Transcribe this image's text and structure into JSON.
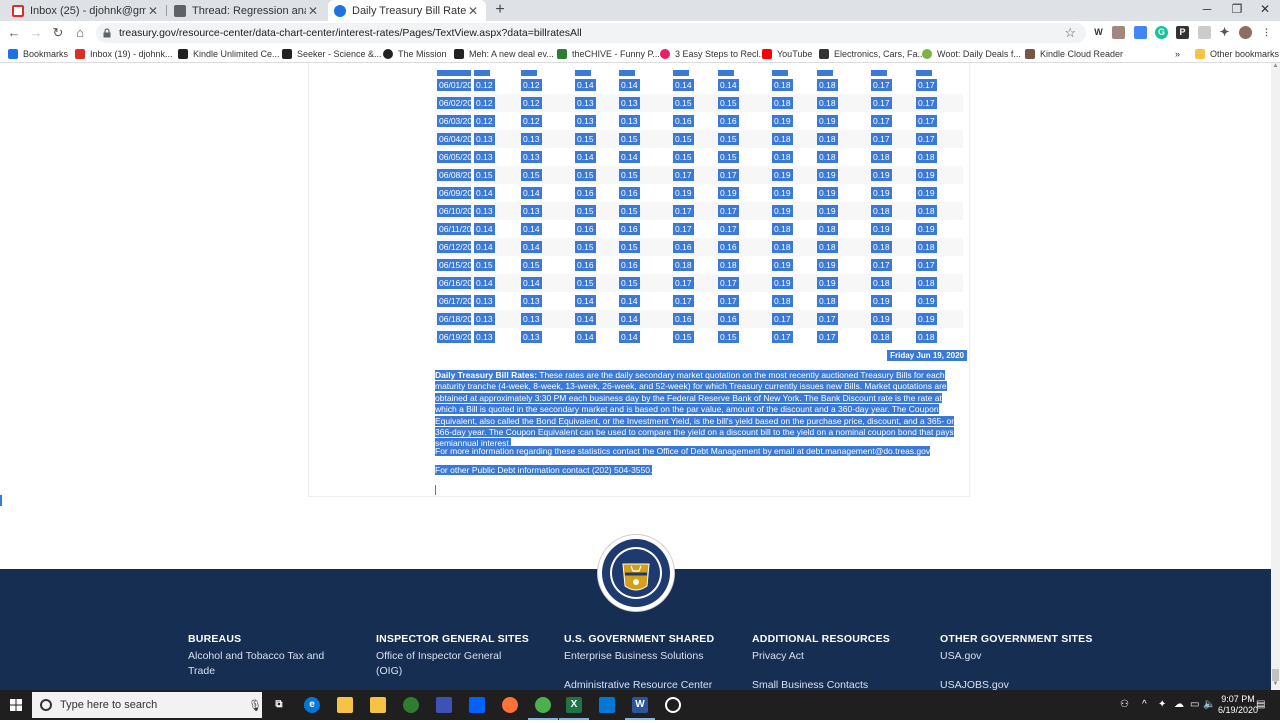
{
  "browser": {
    "tabs": [
      {
        "title": "Inbox (25) - djohnk@gmail.com",
        "favicon_color": "#d93025",
        "active": false
      },
      {
        "title": "Thread: Regression analysis to ca",
        "favicon_color": "#5f6368",
        "active": false
      },
      {
        "title": "Daily Treasury Bill Rates Data",
        "favicon_color": "#1a73e8",
        "active": true
      }
    ],
    "new_tab": "+",
    "window_controls": {
      "minimize": "─",
      "restore": "❐",
      "close": "✕"
    },
    "nav": {
      "back": "←",
      "forward": "→",
      "reload": "↻",
      "home": "⌂"
    },
    "url": "treasury.gov/resource-center/data-chart-center/interest-rates/Pages/TextView.aspx?data=billratesAll",
    "bookmark_star": "☆",
    "bookmarks": [
      {
        "label": "Bookmarks",
        "color": "#1a73e8"
      },
      {
        "label": "Inbox (19) - djohnk...",
        "color": "#d93025"
      },
      {
        "label": "Kindle Unlimited Ce...",
        "color": "#222"
      },
      {
        "label": "Seeker - Science &...",
        "color": "#222"
      },
      {
        "label": "The Mission",
        "color": "#222"
      },
      {
        "label": "Meh: A new deal ev...",
        "color": "#222"
      },
      {
        "label": "theCHIVE - Funny P...",
        "color": "#2e7d32"
      },
      {
        "label": "3 Easy Steps to Recl...",
        "color": "#e91e63"
      },
      {
        "label": "YouTube",
        "color": "#ff0000"
      },
      {
        "label": "Electronics, Cars, Fa...",
        "color": "#333"
      },
      {
        "label": "Woot: Daily Deals f...",
        "color": "#7cb342"
      },
      {
        "label": "Kindle Cloud Reader",
        "color": "#795548"
      },
      {
        "label": "»",
        "color": "transparent"
      },
      {
        "label": "Other bookmarks",
        "color": "#f6c344"
      }
    ]
  },
  "rates_table": {
    "rows": [
      {
        "date": "06/01/20",
        "values": [
          "0.12",
          "0.12",
          "0.14",
          "0.14",
          "0.14",
          "0.14",
          "0.18",
          "0.18",
          "0.17",
          "0.17"
        ]
      },
      {
        "date": "06/02/20",
        "values": [
          "0.12",
          "0.12",
          "0.13",
          "0.13",
          "0.15",
          "0.15",
          "0.18",
          "0.18",
          "0.17",
          "0.17"
        ]
      },
      {
        "date": "06/03/20",
        "values": [
          "0.12",
          "0.12",
          "0.13",
          "0.13",
          "0.16",
          "0.16",
          "0.19",
          "0.19",
          "0.17",
          "0.17"
        ]
      },
      {
        "date": "06/04/20",
        "values": [
          "0.13",
          "0.13",
          "0.15",
          "0.15",
          "0.15",
          "0.15",
          "0.18",
          "0.18",
          "0.17",
          "0.17"
        ]
      },
      {
        "date": "06/05/20",
        "values": [
          "0.13",
          "0.13",
          "0.14",
          "0.14",
          "0.15",
          "0.15",
          "0.18",
          "0.18",
          "0.18",
          "0.18"
        ]
      },
      {
        "date": "06/08/20",
        "values": [
          "0.15",
          "0.15",
          "0.15",
          "0.15",
          "0.17",
          "0.17",
          "0.19",
          "0.19",
          "0.19",
          "0.19"
        ]
      },
      {
        "date": "06/09/20",
        "values": [
          "0.14",
          "0.14",
          "0.16",
          "0.16",
          "0.19",
          "0.19",
          "0.19",
          "0.19",
          "0.19",
          "0.19"
        ]
      },
      {
        "date": "06/10/20",
        "values": [
          "0.13",
          "0.13",
          "0.15",
          "0.15",
          "0.17",
          "0.17",
          "0.19",
          "0.19",
          "0.18",
          "0.18"
        ]
      },
      {
        "date": "06/11/20",
        "values": [
          "0.14",
          "0.14",
          "0.16",
          "0.16",
          "0.17",
          "0.17",
          "0.18",
          "0.18",
          "0.19",
          "0.19"
        ]
      },
      {
        "date": "06/12/20",
        "values": [
          "0.14",
          "0.14",
          "0.15",
          "0.15",
          "0.16",
          "0.16",
          "0.18",
          "0.18",
          "0.18",
          "0.18"
        ]
      },
      {
        "date": "06/15/20",
        "values": [
          "0.15",
          "0.15",
          "0.16",
          "0.16",
          "0.18",
          "0.18",
          "0.19",
          "0.19",
          "0.17",
          "0.17"
        ]
      },
      {
        "date": "06/16/20",
        "values": [
          "0.14",
          "0.14",
          "0.15",
          "0.15",
          "0.17",
          "0.17",
          "0.19",
          "0.19",
          "0.18",
          "0.18"
        ]
      },
      {
        "date": "06/17/20",
        "values": [
          "0.13",
          "0.13",
          "0.14",
          "0.14",
          "0.17",
          "0.17",
          "0.18",
          "0.18",
          "0.19",
          "0.19"
        ]
      },
      {
        "date": "06/18/20",
        "values": [
          "0.13",
          "0.13",
          "0.14",
          "0.14",
          "0.16",
          "0.16",
          "0.17",
          "0.17",
          "0.19",
          "0.19"
        ]
      },
      {
        "date": "06/19/20",
        "values": [
          "0.13",
          "0.13",
          "0.14",
          "0.14",
          "0.15",
          "0.15",
          "0.17",
          "0.17",
          "0.18",
          "0.18"
        ]
      }
    ],
    "as_of": "Friday Jun 19, 2020"
  },
  "notes": {
    "definition_title": "Daily Treasury Bill Rates:",
    "definition_body": "These rates are the daily secondary market quotation on the most recently auctioned Treasury Bills for each maturity tranche (4-week, 8-week, 13-week, 26-week, and 52-week) for which Treasury currently issues new Bills. Market quotations are obtained at approximately 3:30 PM each business day by the Federal Reserve Bank of New York. The Bank Discount rate is the rate at which a Bill is quoted in the secondary market and is based on the par value, amount of the discount and a 360-day year. The Coupon Equivalent, also called the Bond Equivalent, or the Investment Yield, is the bill's yield based on the purchase price, discount, and a 365- or 366-day year. The Coupon Equivalent can be used to compare the yield on a discount bill to the yield on a nominal coupon bond that pays semiannual interest.",
    "contact_debt_mgmt": "For more information regarding these statistics contact the Office of Debt Management by email at debt.management@do.treas.gov",
    "contact_public_debt": "For other Public Debt information contact (202) 504-3550."
  },
  "footer": {
    "columns": [
      {
        "heading": "BUREAUS",
        "links": [
          "Alcohol and Tobacco Tax and Trade"
        ]
      },
      {
        "heading": "INSPECTOR GENERAL SITES",
        "links": [
          "Office of Inspector General (OIG)"
        ]
      },
      {
        "heading": "U.S. GOVERNMENT SHARED",
        "links": [
          "Enterprise Business Solutions",
          "Administrative Resource Center"
        ]
      },
      {
        "heading": "ADDITIONAL RESOURCES",
        "links": [
          "Privacy Act",
          "Small Business Contacts"
        ]
      },
      {
        "heading": "OTHER GOVERNMENT SITES",
        "links": [
          "USA.gov",
          "USAJOBS.gov"
        ]
      }
    ],
    "seal_text": "THE DEPARTMENT OF THE TREASURY 1789",
    "colors": {
      "background": "#162e51",
      "seal_gold": "#d4a017"
    }
  },
  "taskbar": {
    "search_placeholder": "Type here to search",
    "time": "9:07 PM",
    "date": "6/19/2020"
  },
  "colors": {
    "selection": "#3a79d7",
    "footer_bg": "#162e51"
  }
}
